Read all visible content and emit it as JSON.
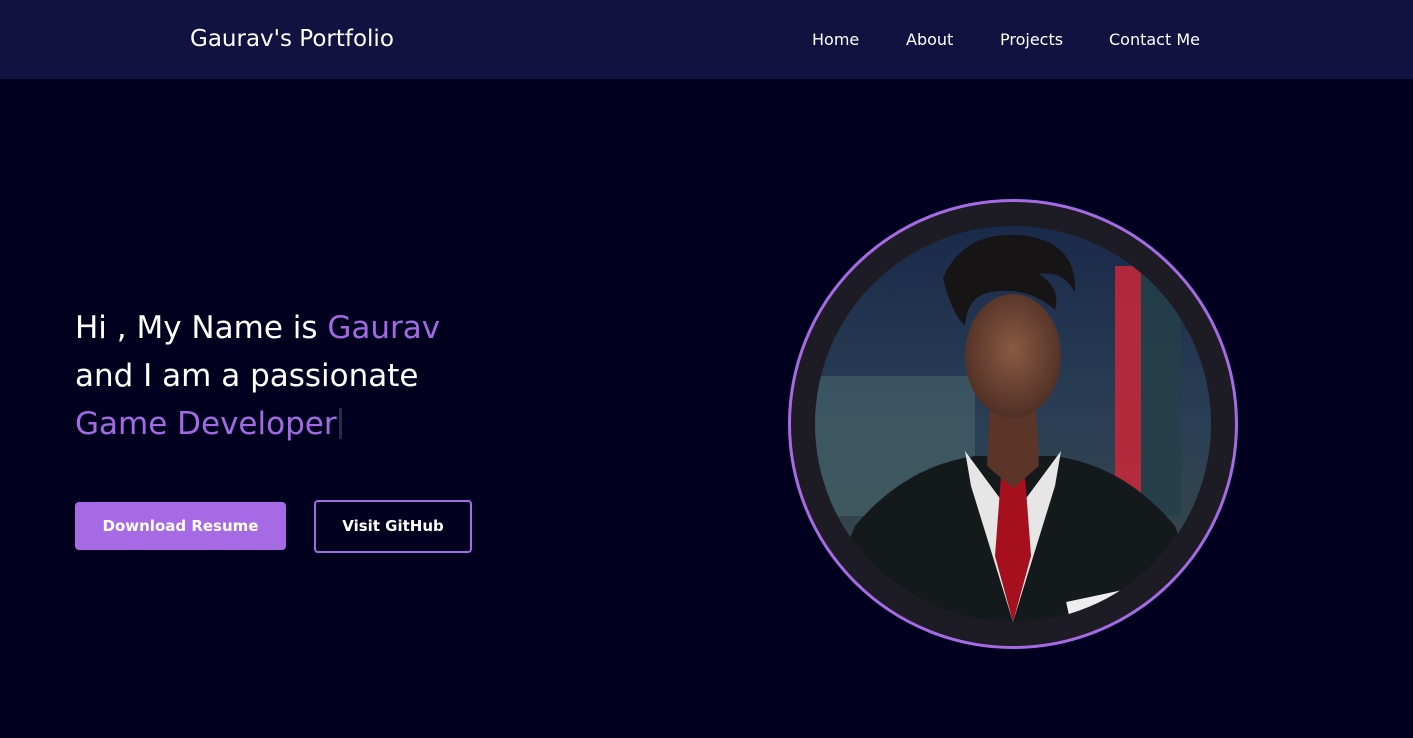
{
  "navbar": {
    "brand": "Gaurav's Portfolio",
    "links": [
      {
        "label": "Home"
      },
      {
        "label": "About"
      },
      {
        "label": "Projects"
      },
      {
        "label": "Contact Me"
      }
    ]
  },
  "hero": {
    "greeting_prefix": "Hi , My Name is ",
    "name": "Gaurav",
    "line2": "and I am a passionate",
    "role": "Game Developer",
    "buttons": {
      "download_resume": "Download Resume",
      "visit_github": "Visit GitHub"
    }
  },
  "profile_photo": {
    "icon": "profile-photo"
  },
  "colors": {
    "background": "#01001f",
    "navbar": "#121240",
    "accent": "#a56ae4",
    "text": "#ffffff"
  }
}
